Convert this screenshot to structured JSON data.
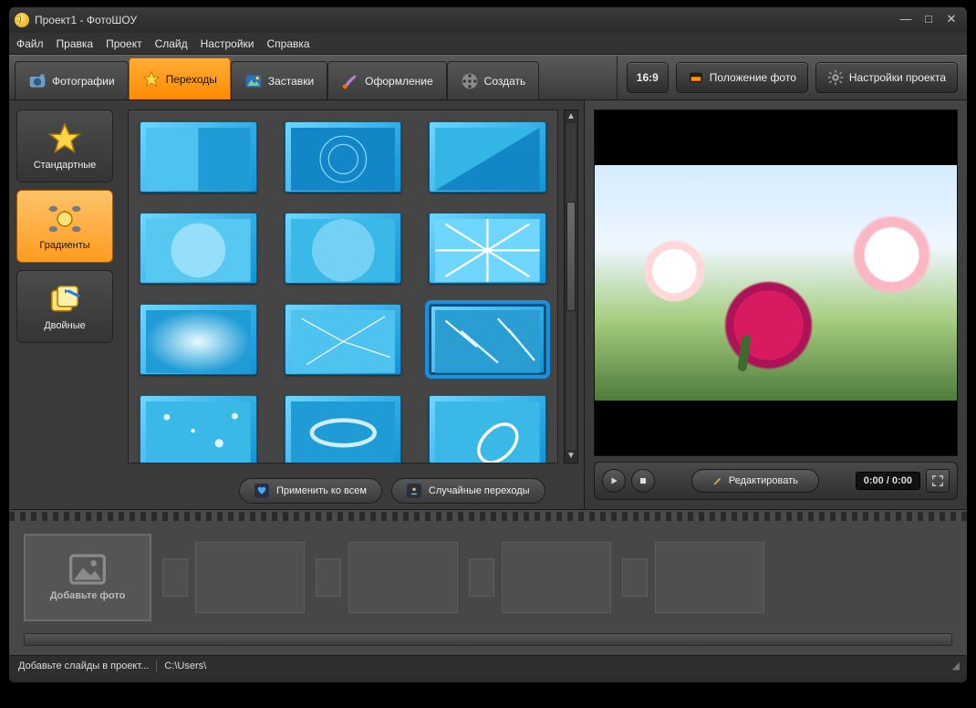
{
  "window": {
    "title": "Проект1 - ФотоШОУ"
  },
  "menu": {
    "file": "Файл",
    "edit": "Правка",
    "project": "Проект",
    "slide": "Слайд",
    "settings": "Настройки",
    "help": "Справка"
  },
  "tabs": {
    "photos": "Фотографии",
    "transitions": "Переходы",
    "titles": "Заставки",
    "decor": "Оформление",
    "create": "Создать",
    "active": "transitions"
  },
  "toolbar": {
    "aspect": "16:9",
    "photo_pos": "Положение фото",
    "project_settings": "Настройки проекта"
  },
  "categories": {
    "standard": "Стандартные",
    "gradients": "Градиенты",
    "double": "Двойные",
    "selected": "gradients"
  },
  "gallery": {
    "count": 12,
    "selected_index": 8,
    "apply_all": "Применить ко всем",
    "random": "Случайные переходы"
  },
  "preview": {
    "edit": "Редактировать",
    "time": "0:00 / 0:00"
  },
  "timeline": {
    "add_photo": "Добавьте фото",
    "empty_pairs": 4
  },
  "status": {
    "hint": "Добавьте слайды в проект...",
    "path": "C:\\Users\\"
  }
}
